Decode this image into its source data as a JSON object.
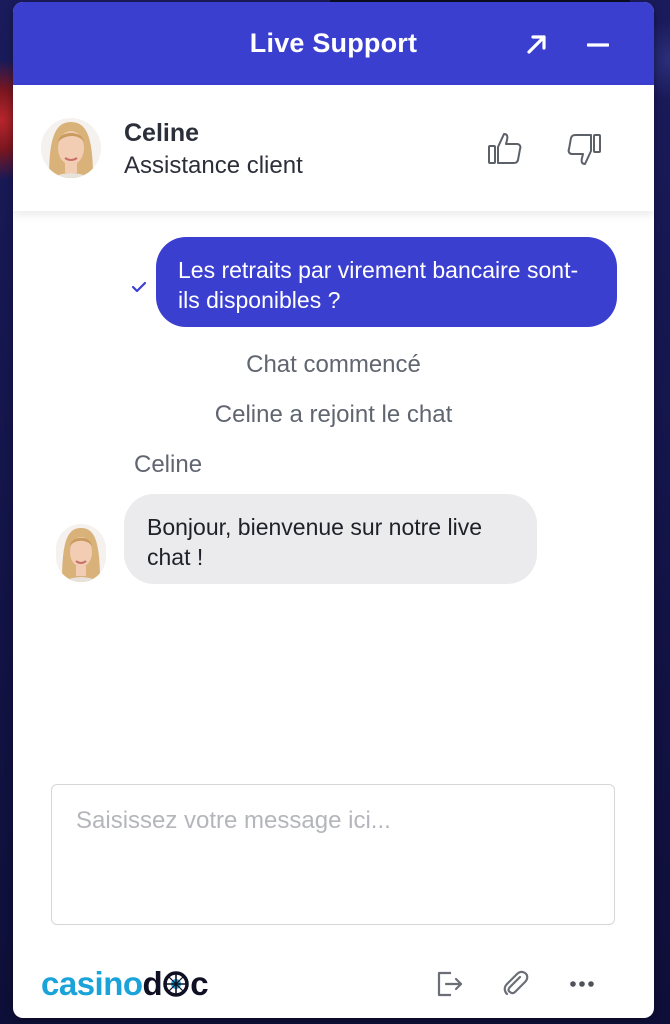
{
  "header": {
    "title": "Live Support",
    "expand_icon": "arrow-up-right-icon",
    "minimize_icon": "minus-icon",
    "background_color": "#3b3fd0"
  },
  "agent": {
    "name": "Celine",
    "role": "Assistance client",
    "avatar_icon": "agent-avatar",
    "thumb_up_icon": "thumbs-up-icon",
    "thumb_down_icon": "thumbs-down-icon"
  },
  "chat": {
    "messages": [
      {
        "from": "user",
        "text": "Les retraits par virement bancaire sont-ils disponibles ?",
        "status_icon": "check-icon"
      },
      {
        "from": "system",
        "text": "Chat commencé"
      },
      {
        "from": "system",
        "text": "Celine a rejoint le chat"
      },
      {
        "from": "agent",
        "sender": "Celine",
        "text": "Bonjour, bienvenue sur notre live chat !"
      }
    ],
    "user_bubble_color": "#3b3fd0",
    "agent_bubble_color": "#ebebee"
  },
  "composer": {
    "placeholder": "Saisissez votre message ici...",
    "value": ""
  },
  "footer": {
    "brand_part1": "casino",
    "brand_part2": "d",
    "brand_part3": "c",
    "exit_icon": "exit-icon",
    "attach_icon": "paperclip-icon",
    "more_icon": "more-horizontal-icon"
  }
}
